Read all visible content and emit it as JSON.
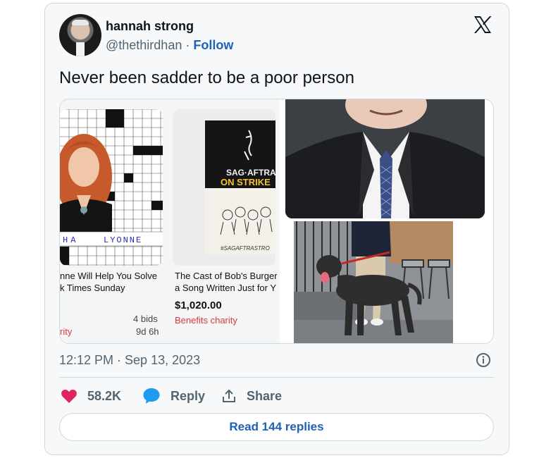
{
  "tweet": {
    "display_name": "hannah strong",
    "handle": "@thethirdhan",
    "separator": "·",
    "follow_label": "Follow",
    "text": "Never been sadder to be a poor person",
    "timestamp": "12:12 PM · Sep 13, 2023",
    "likes": "58.2K",
    "reply_label": "Reply",
    "share_label": "Share",
    "read_replies_label": "Read 144 replies",
    "colors": {
      "like": "#e0245e",
      "reply": "#1d9bf0",
      "link": "#1d62b8"
    }
  },
  "media": {
    "item1": {
      "puzzle_letters_left": "HA",
      "puzzle_letters_right": "LYONNE",
      "caption_line1": "nne Will Help You Solve",
      "caption_line2": "k Times Sunday",
      "bids": "4 bids",
      "time_left": "9d 6h",
      "charity": "rity"
    },
    "item2": {
      "poster_line1": "SAG·AFTRA",
      "poster_line2": "ON STRIKE",
      "poster_tag": "#SAGAFTRASTRO",
      "caption_line1": "The Cast of Bob's Burger",
      "caption_line2": "a Song Written Just for Y",
      "price": "$1,020.00",
      "charity": "Benefits charity"
    }
  }
}
